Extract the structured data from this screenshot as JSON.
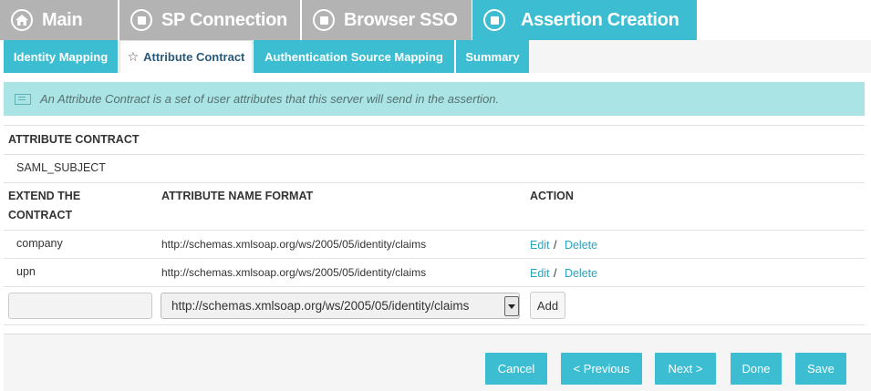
{
  "top_tabs": [
    {
      "label": "Main",
      "icon": "home-icon"
    },
    {
      "label": "SP Connection",
      "icon": "circle-square-icon"
    },
    {
      "label": "Browser SSO",
      "icon": "circle-square-icon"
    },
    {
      "label": "Assertion Creation",
      "icon": "circle-square-icon",
      "active": true
    }
  ],
  "sub_tabs": [
    {
      "label": "Identity Mapping"
    },
    {
      "label": "Attribute Contract",
      "active": true
    },
    {
      "label": "Authentication Source Mapping"
    },
    {
      "label": "Summary"
    }
  ],
  "info_text": "An Attribute Contract is a set of user attributes that this server will send in the assertion.",
  "attribute_contract_heading": "ATTRIBUTE CONTRACT",
  "saml_subject": "SAML_SUBJECT",
  "columns": {
    "extend_line1": "EXTEND THE",
    "extend_line2": "CONTRACT",
    "format": "ATTRIBUTE NAME FORMAT",
    "action": "ACTION"
  },
  "rows": [
    {
      "name": "company",
      "format": "http://schemas.xmlsoap.org/ws/2005/05/identity/claims",
      "edit": "Edit",
      "sep": "/",
      "delete": "Delete"
    },
    {
      "name": "upn",
      "format": "http://schemas.xmlsoap.org/ws/2005/05/identity/claims",
      "edit": "Edit",
      "sep": "/",
      "delete": "Delete"
    }
  ],
  "new_row": {
    "name_value": "",
    "format_selected": "http://schemas.xmlsoap.org/ws/2005/05/identity/claims",
    "add_label": "Add"
  },
  "footer_buttons": {
    "cancel": "Cancel",
    "previous": "< Previous",
    "next": "Next >",
    "done": "Done",
    "save": "Save"
  },
  "colors": {
    "accent": "#3cbdd1",
    "tab_inactive": "#b3b3b3",
    "info_bg": "#abe4e4",
    "link": "#2aa3bd"
  }
}
